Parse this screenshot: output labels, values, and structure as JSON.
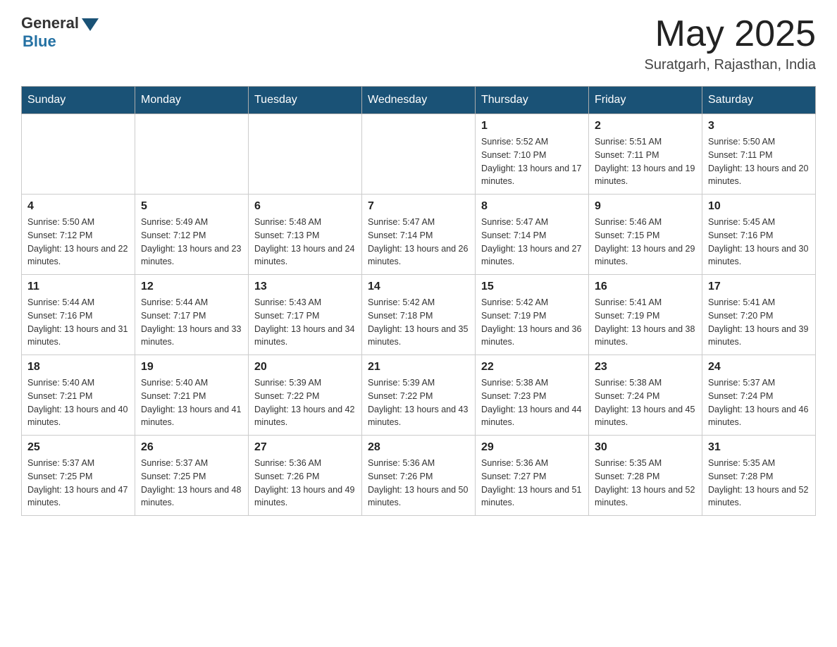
{
  "header": {
    "logo_text_general": "General",
    "logo_text_blue": "Blue",
    "month_year": "May 2025",
    "location": "Suratgarh, Rajasthan, India"
  },
  "days_of_week": [
    "Sunday",
    "Monday",
    "Tuesday",
    "Wednesday",
    "Thursday",
    "Friday",
    "Saturday"
  ],
  "weeks": [
    {
      "days": [
        {
          "num": "",
          "info": ""
        },
        {
          "num": "",
          "info": ""
        },
        {
          "num": "",
          "info": ""
        },
        {
          "num": "",
          "info": ""
        },
        {
          "num": "1",
          "info": "Sunrise: 5:52 AM\nSunset: 7:10 PM\nDaylight: 13 hours and 17 minutes."
        },
        {
          "num": "2",
          "info": "Sunrise: 5:51 AM\nSunset: 7:11 PM\nDaylight: 13 hours and 19 minutes."
        },
        {
          "num": "3",
          "info": "Sunrise: 5:50 AM\nSunset: 7:11 PM\nDaylight: 13 hours and 20 minutes."
        }
      ]
    },
    {
      "days": [
        {
          "num": "4",
          "info": "Sunrise: 5:50 AM\nSunset: 7:12 PM\nDaylight: 13 hours and 22 minutes."
        },
        {
          "num": "5",
          "info": "Sunrise: 5:49 AM\nSunset: 7:12 PM\nDaylight: 13 hours and 23 minutes."
        },
        {
          "num": "6",
          "info": "Sunrise: 5:48 AM\nSunset: 7:13 PM\nDaylight: 13 hours and 24 minutes."
        },
        {
          "num": "7",
          "info": "Sunrise: 5:47 AM\nSunset: 7:14 PM\nDaylight: 13 hours and 26 minutes."
        },
        {
          "num": "8",
          "info": "Sunrise: 5:47 AM\nSunset: 7:14 PM\nDaylight: 13 hours and 27 minutes."
        },
        {
          "num": "9",
          "info": "Sunrise: 5:46 AM\nSunset: 7:15 PM\nDaylight: 13 hours and 29 minutes."
        },
        {
          "num": "10",
          "info": "Sunrise: 5:45 AM\nSunset: 7:16 PM\nDaylight: 13 hours and 30 minutes."
        }
      ]
    },
    {
      "days": [
        {
          "num": "11",
          "info": "Sunrise: 5:44 AM\nSunset: 7:16 PM\nDaylight: 13 hours and 31 minutes."
        },
        {
          "num": "12",
          "info": "Sunrise: 5:44 AM\nSunset: 7:17 PM\nDaylight: 13 hours and 33 minutes."
        },
        {
          "num": "13",
          "info": "Sunrise: 5:43 AM\nSunset: 7:17 PM\nDaylight: 13 hours and 34 minutes."
        },
        {
          "num": "14",
          "info": "Sunrise: 5:42 AM\nSunset: 7:18 PM\nDaylight: 13 hours and 35 minutes."
        },
        {
          "num": "15",
          "info": "Sunrise: 5:42 AM\nSunset: 7:19 PM\nDaylight: 13 hours and 36 minutes."
        },
        {
          "num": "16",
          "info": "Sunrise: 5:41 AM\nSunset: 7:19 PM\nDaylight: 13 hours and 38 minutes."
        },
        {
          "num": "17",
          "info": "Sunrise: 5:41 AM\nSunset: 7:20 PM\nDaylight: 13 hours and 39 minutes."
        }
      ]
    },
    {
      "days": [
        {
          "num": "18",
          "info": "Sunrise: 5:40 AM\nSunset: 7:21 PM\nDaylight: 13 hours and 40 minutes."
        },
        {
          "num": "19",
          "info": "Sunrise: 5:40 AM\nSunset: 7:21 PM\nDaylight: 13 hours and 41 minutes."
        },
        {
          "num": "20",
          "info": "Sunrise: 5:39 AM\nSunset: 7:22 PM\nDaylight: 13 hours and 42 minutes."
        },
        {
          "num": "21",
          "info": "Sunrise: 5:39 AM\nSunset: 7:22 PM\nDaylight: 13 hours and 43 minutes."
        },
        {
          "num": "22",
          "info": "Sunrise: 5:38 AM\nSunset: 7:23 PM\nDaylight: 13 hours and 44 minutes."
        },
        {
          "num": "23",
          "info": "Sunrise: 5:38 AM\nSunset: 7:24 PM\nDaylight: 13 hours and 45 minutes."
        },
        {
          "num": "24",
          "info": "Sunrise: 5:37 AM\nSunset: 7:24 PM\nDaylight: 13 hours and 46 minutes."
        }
      ]
    },
    {
      "days": [
        {
          "num": "25",
          "info": "Sunrise: 5:37 AM\nSunset: 7:25 PM\nDaylight: 13 hours and 47 minutes."
        },
        {
          "num": "26",
          "info": "Sunrise: 5:37 AM\nSunset: 7:25 PM\nDaylight: 13 hours and 48 minutes."
        },
        {
          "num": "27",
          "info": "Sunrise: 5:36 AM\nSunset: 7:26 PM\nDaylight: 13 hours and 49 minutes."
        },
        {
          "num": "28",
          "info": "Sunrise: 5:36 AM\nSunset: 7:26 PM\nDaylight: 13 hours and 50 minutes."
        },
        {
          "num": "29",
          "info": "Sunrise: 5:36 AM\nSunset: 7:27 PM\nDaylight: 13 hours and 51 minutes."
        },
        {
          "num": "30",
          "info": "Sunrise: 5:35 AM\nSunset: 7:28 PM\nDaylight: 13 hours and 52 minutes."
        },
        {
          "num": "31",
          "info": "Sunrise: 5:35 AM\nSunset: 7:28 PM\nDaylight: 13 hours and 52 minutes."
        }
      ]
    }
  ]
}
